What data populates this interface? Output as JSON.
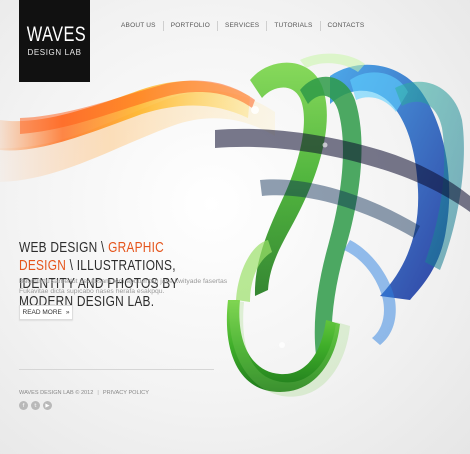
{
  "logo": {
    "title": "WAVES",
    "subtitle": "DESIGN LAB"
  },
  "nav": {
    "items": [
      "ABOUT US",
      "PORTFOLIO",
      "SERVICES",
      "TUTORIALS",
      "CONTACTS"
    ]
  },
  "hero": {
    "headline_part1": "WEB DESIGN \\ ",
    "headline_highlight": "GRAPHIC DESIGN",
    "headline_part2": " \\ ILLUSTRATIONS, IDENTITY AND PHOTOS BY MODERN DESIGN LAB.",
    "body": "Baomindu samedut pecabsam rem apquentab jase kwityade fasertas Fukavitae dicta supicabo nases herafa esakpqu.",
    "button_label": "READ MORE",
    "button_arrow": "»"
  },
  "footer": {
    "copyright": "WAVES DESIGN LAB © 2012",
    "separator": "|",
    "privacy": "PRIVACY POLICY"
  },
  "social": {
    "icons": [
      "facebook-icon",
      "twitter-icon",
      "youtube-icon"
    ],
    "glyphs": [
      "f",
      "t",
      "▶"
    ]
  },
  "colors": {
    "accent": "#e5541b",
    "logo_bg": "#111111",
    "text_dark": "#2d2d2d",
    "text_muted": "#9a9a9a"
  }
}
